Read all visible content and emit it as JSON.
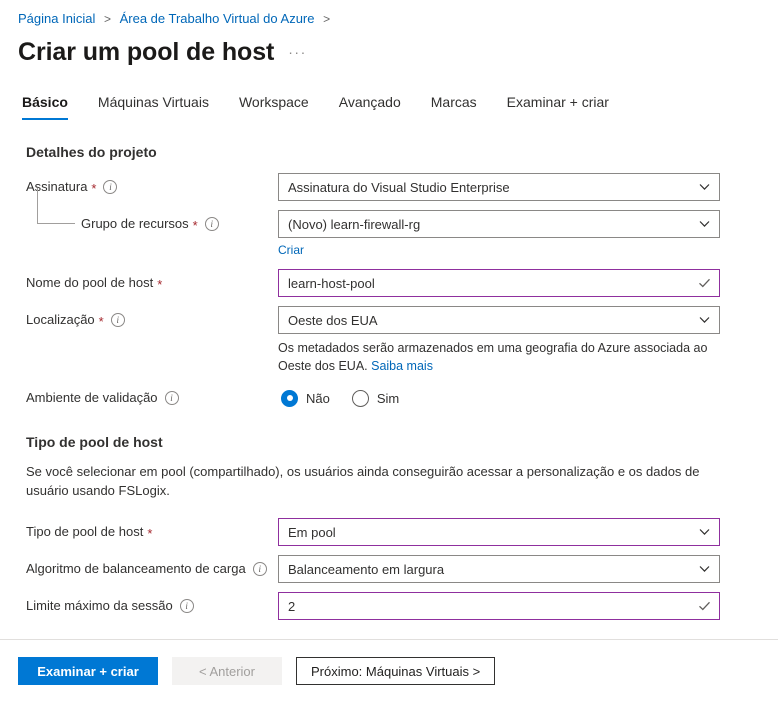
{
  "breadcrumb": {
    "items": [
      {
        "label": "Página Inicial"
      },
      {
        "label": "Área de Trabalho Virtual do Azure"
      }
    ],
    "separator": ">"
  },
  "header": {
    "title": "Criar um pool de host",
    "more_menu": "···"
  },
  "tabs": [
    {
      "label": "Básico",
      "active": true
    },
    {
      "label": "Máquinas Virtuais",
      "active": false
    },
    {
      "label": "Workspace",
      "active": false
    },
    {
      "label": "Avançado",
      "active": false
    },
    {
      "label": "Marcas",
      "active": false
    },
    {
      "label": "Examinar + criar",
      "active": false
    }
  ],
  "project_details": {
    "heading": "Detalhes do projeto",
    "subscription": {
      "label": "Assinatura",
      "required": "*",
      "value": "Assinatura do Visual Studio Enterprise"
    },
    "resource_group": {
      "label": "Grupo de recursos",
      "required": "*",
      "value": "(Novo) learn-firewall-rg",
      "create_link": "Criar"
    },
    "host_pool_name": {
      "label": "Nome do pool de host",
      "required": "*",
      "value": "learn-host-pool",
      "placeholder": ""
    },
    "location": {
      "label": "Localização",
      "required": "*",
      "value": "Oeste dos EUA",
      "help_text": "Os metadados serão armazenados em uma geografia do Azure associada ao Oeste dos EUA.",
      "help_link": "Saiba mais"
    },
    "validation_environment": {
      "label": "Ambiente de validação",
      "options": [
        {
          "label": "Não",
          "selected": true
        },
        {
          "label": "Sim",
          "selected": false
        }
      ]
    }
  },
  "host_pool_type": {
    "heading": "Tipo de pool de host",
    "description": "Se você selecionar em pool (compartilhado), os usuários ainda conseguirão acessar a personalização e os dados de usuário usando FSLogix.",
    "pool_type": {
      "label": "Tipo de pool de host",
      "required": "*",
      "value": "Em pool"
    },
    "load_balancing": {
      "label": "Algoritmo de balanceamento de carga",
      "value": "Balanceamento em largura"
    },
    "max_session_limit": {
      "label": "Limite máximo da sessão",
      "value": "2"
    }
  },
  "footer": {
    "review_create": "Examinar + criar",
    "previous": "< Anterior",
    "next": "Próximo: Máquinas Virtuais >"
  },
  "colors": {
    "accent": "#0078d4",
    "link": "#0067b8",
    "required": "#a4262c",
    "field_focus_border": "#8f2f9e",
    "field_border": "#8a8886"
  }
}
